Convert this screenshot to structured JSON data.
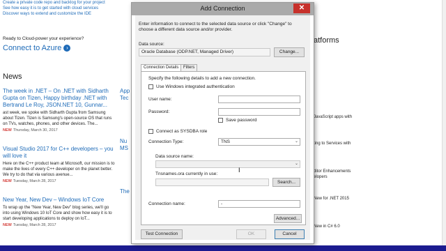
{
  "background": {
    "top_links": [
      "Create a private code repo and backlog for your project",
      "See how easy it is to get started with cloud services",
      "Discover ways to extend and customize the IDE"
    ],
    "ready_text": "Ready to Cloud-power your experience?",
    "connect_azure": "Connect to Azure",
    "right_heading": "atforms",
    "news_heading": "News",
    "news": [
      {
        "title": "The week in .NET – On .NET with Sidharth Gupta on Tizen, Happy birthday .NET with Bertrand Le Roy, JSON.NET 10, Gunnar...",
        "body": "ast week, we spoke with Sidharth Gupta from Samsung about Tizen. Tizen is Samsung's open-source OS that runs on TVs, watches, phones, and other devices. The...",
        "badge": "NEW",
        "date": "Thursday, March 30, 2017"
      },
      {
        "title": "Visual Studio 2017 for C++ developers – you will love it",
        "body": "Here on the C++ product team at Microsoft, our mission is to make the lives of every C++ developer on the planet better. We try to do that via various avenue...",
        "badge": "NEW",
        "date": "Tuesday, March 28, 2017"
      },
      {
        "title": "New Year, New Dev – Windows IoT Core",
        "body": "To wrap up the \"New Year, New Dev\" blog series, we'll go into using Windows 10 IoT Core and show how easy it is to start developing applications to deploy on IoT...",
        "badge": "NEW",
        "date": "Tuesday, March 28, 2017"
      }
    ],
    "middle_fragments": [
      "App",
      "Tec",
      "Nu",
      "MS",
      "The"
    ],
    "right_fragments": [
      "JavaScript apps with",
      "ting to Services with",
      "ditor Enhancements",
      "elopers",
      "New for .NET 2015",
      "New in C# 6.0"
    ]
  },
  "dialog": {
    "title": "Add Connection",
    "intro": "Enter information to connect to the selected data source or click \"Change\" to choose a different data source and/or provider.",
    "data_source_label": "Data source:",
    "data_source_value": "Oracle Database (ODP.NET, Managed Driver)",
    "change_button": "Change...",
    "tabs": [
      "Connection Details",
      "Filters"
    ],
    "details_text": "Specify the following details to add a new connection.",
    "use_windows_auth": "Use Windows integrated authentication",
    "username_label": "User name:",
    "username_value": "",
    "password_label": "Password:",
    "password_value": "",
    "save_password": "Save password",
    "connect_sysdba": "Connect as SYSDBA role",
    "connection_type_label": "Connection Type:",
    "connection_type_value": "TNS",
    "data_source_name_label": "Data source name:",
    "data_source_name_value": "",
    "tnsnames_label": "Tnsnames.ora currently in use:",
    "tnsnames_value": "",
    "search_button": "Search...",
    "connection_name_label": "Connection name:",
    "connection_name_value": "-",
    "advanced_button": "Advanced...",
    "test_button": "Test Connection",
    "ok_button": "OK",
    "cancel_button": "Cancel"
  }
}
